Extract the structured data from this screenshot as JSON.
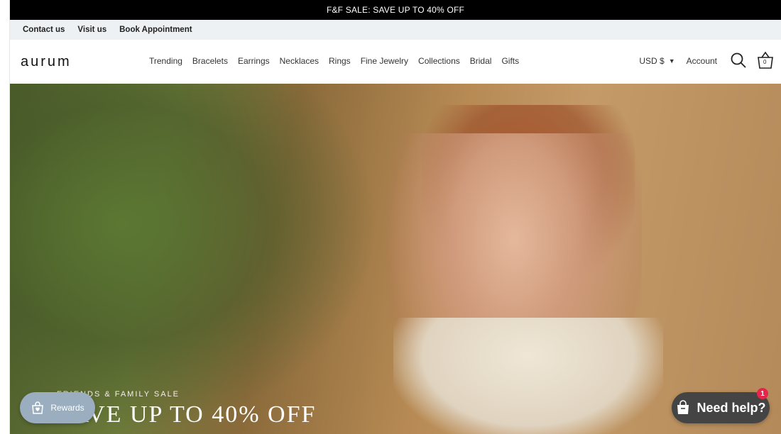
{
  "announcement": {
    "text": "F&F SALE: SAVE UP TO 40% OFF"
  },
  "utility": {
    "links": [
      "Contact us",
      "Visit us",
      "Book Appointment"
    ]
  },
  "header": {
    "logo": "aurum",
    "menu": [
      "Trending",
      "Bracelets",
      "Earrings",
      "Necklaces",
      "Rings",
      "Fine Jewelry",
      "Collections",
      "Bridal",
      "Gifts"
    ],
    "currency": "USD $",
    "account": "Account",
    "cart_count": "0"
  },
  "hero": {
    "eyebrow": "FRIENDS & FAMILY SALE",
    "title": "SAVE UP TO 40% OFF"
  },
  "widgets": {
    "rewards_label": "Rewards",
    "help_label": "Need help?",
    "help_badge": "1"
  },
  "colors": {
    "announcement_bg": "#000000",
    "utility_bg": "#eef1f3",
    "rewards_bg": "#9aaec0",
    "help_bg": "#444444",
    "badge": "#e5264a"
  }
}
